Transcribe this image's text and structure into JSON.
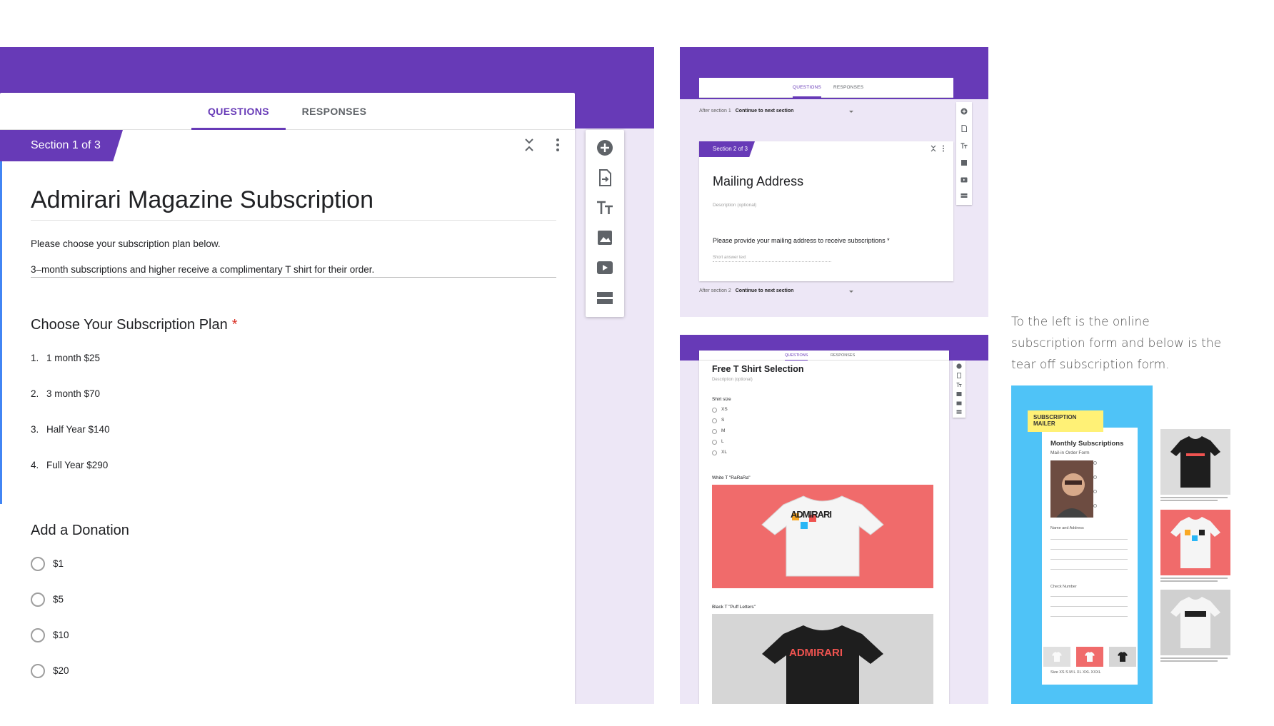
{
  "main": {
    "tabs": [
      {
        "label": "QUESTIONS",
        "active": true
      },
      {
        "label": "RESPONSES",
        "active": false
      }
    ],
    "section_badge": "Section 1 of 3",
    "title": "Admirari Magazine Subscription",
    "description": [
      "Please choose your subscription plan below.",
      "3–month subscriptions and higher receive a complimentary T shirt for their order."
    ],
    "question1": {
      "title": "Choose Your Subscription Plan",
      "required_mark": "*",
      "options": [
        {
          "num": "1.",
          "label": "1 month $25"
        },
        {
          "num": "2.",
          "label": "3 month $70"
        },
        {
          "num": "3.",
          "label": "Half Year $140"
        },
        {
          "num": "4.",
          "label": "Full Year $290"
        }
      ]
    },
    "question2": {
      "title": "Add a Donation",
      "options": [
        "$1",
        "$5",
        "$10",
        "$20"
      ]
    },
    "toolbar_icons": [
      "add-question-icon",
      "import-questions-icon",
      "add-title-icon",
      "add-image-icon",
      "add-video-icon",
      "add-section-icon"
    ]
  },
  "panel_mailing": {
    "tabs": [
      {
        "label": "QUESTIONS",
        "active": true
      },
      {
        "label": "RESPONSES",
        "active": false
      }
    ],
    "after_section_1": {
      "label": "After section 1",
      "value": "Continue to next section"
    },
    "section_badge": "Section 2 of 3",
    "title": "Mailing Address",
    "description_placeholder": "Description (optional)",
    "question": "Please provide your mailing address to receive subscriptions *",
    "answer_placeholder": "Short answer text",
    "after_section_2": {
      "label": "After section 2",
      "value": "Continue to next section"
    }
  },
  "panel_tshirt": {
    "tabs": [
      {
        "label": "QUESTIONS",
        "active": true
      },
      {
        "label": "RESPONSES",
        "active": false
      }
    ],
    "title": "Free T Shirt Selection",
    "description_placeholder": "Description (optional)",
    "size_label": "Shirt size",
    "sizes": [
      "XS",
      "S",
      "M",
      "L",
      "XL"
    ],
    "white_label": "White T \"RaRaRa\"",
    "black_label": "Black T \"Puff Letters\"",
    "shirt_text": "ADMIRARI"
  },
  "caption": "To the left is the online subscription form and below is the tear off subscription form.",
  "mailer": {
    "tag": "SUBSCRIPTION MAILER",
    "heading": "Monthly Subscriptions",
    "subheading": "Mail-in Order Form",
    "name_label": "Name and Address",
    "check_label": "Check Number",
    "sizes_line": "Size XS S M L XL XXL XXXL"
  },
  "colors": {
    "primary": "#673ab7",
    "background": "#ede7f6",
    "accent_blue": "#4285f4",
    "required_red": "#d93025",
    "mailer_blue": "#4fc3f7",
    "tag_yellow": "#fff176",
    "tee_coral": "#f06b6b"
  }
}
